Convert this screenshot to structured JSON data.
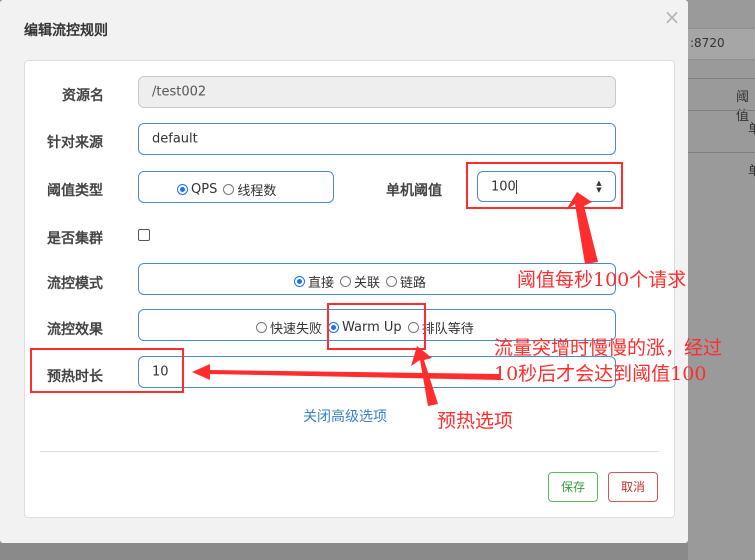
{
  "background": {
    "address_fragment": ":8720",
    "column_header_fragment": "阈值",
    "cell_fragments": [
      "单",
      "单"
    ]
  },
  "dialog": {
    "title": "编辑流控规则",
    "close_glyph": "×"
  },
  "form": {
    "resource_name": {
      "label": "资源名",
      "value": "/test002"
    },
    "limit_app": {
      "label": "针对来源",
      "value": "default"
    },
    "threshold_type": {
      "label": "阈值类型",
      "options": [
        {
          "label": "QPS",
          "selected": true
        },
        {
          "label": "线程数",
          "selected": false
        }
      ]
    },
    "single_threshold": {
      "label": "单机阈值",
      "value": "100"
    },
    "cluster_mode": {
      "label": "是否集群",
      "checked": false
    },
    "strategy": {
      "label": "流控模式",
      "options": [
        {
          "label": "直接",
          "selected": true
        },
        {
          "label": "关联",
          "selected": false
        },
        {
          "label": "链路",
          "selected": false
        }
      ]
    },
    "control_behavior": {
      "label": "流控效果",
      "options": [
        {
          "label": "快速失败",
          "selected": false
        },
        {
          "label": "Warm Up",
          "selected": true
        },
        {
          "label": "排队等待",
          "selected": false
        }
      ]
    },
    "warm_up_period": {
      "label": "预热时长",
      "value": "10"
    },
    "advanced_link": "关闭高级选项"
  },
  "footer": {
    "save_label": "保存",
    "cancel_label": "取消"
  },
  "annotations": {
    "threshold_note": "阈值每秒100个请求",
    "warmup_note_line1": "流量突增时慢慢的涨，经过",
    "warmup_note_line2": "10秒后才会达到阈值100",
    "warmup_option_note": "预热选项",
    "color": "#ff2d2d"
  }
}
